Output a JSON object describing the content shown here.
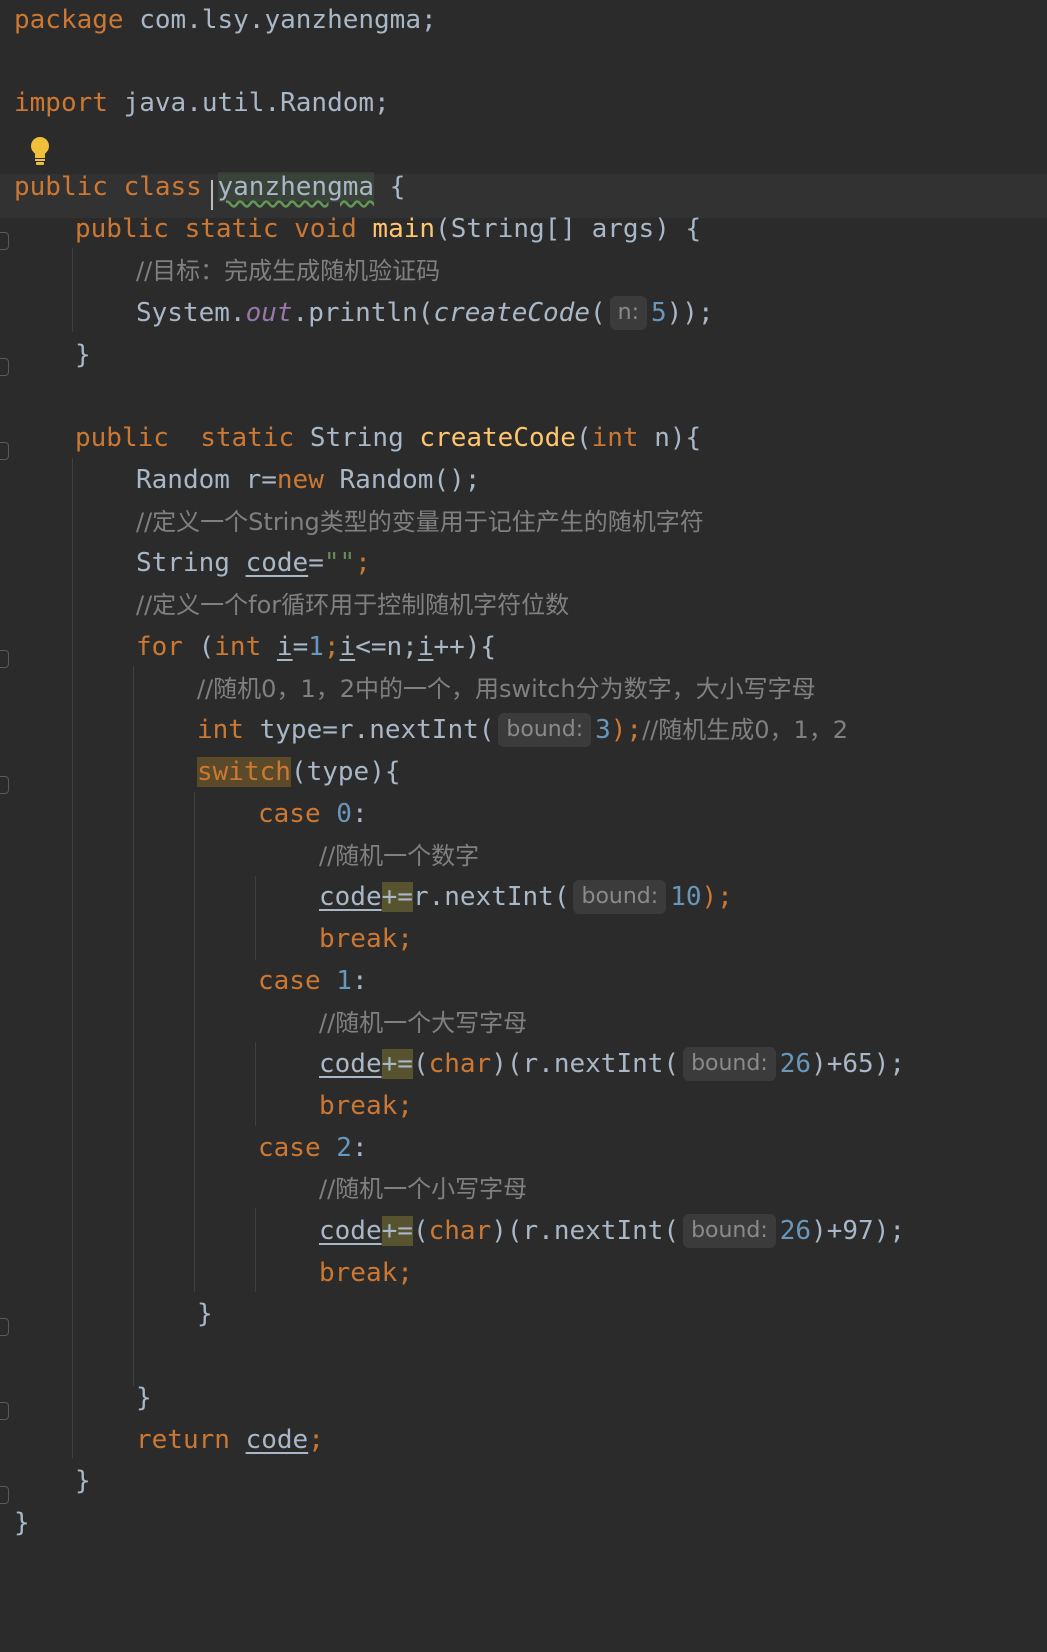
{
  "lines": {
    "l1": {
      "t1": "package",
      "t2": " com.lsy.yanzhengma;"
    },
    "l2": {
      "t1": "import",
      "t2": " java.util.Random;"
    },
    "l3": {
      "t1": "public class ",
      "t2": "yanzhengma",
      "t3": " {"
    },
    "l4": {
      "t1": "public static void ",
      "t2": "main",
      "t3": "(String[] args) {"
    },
    "l5": {
      "t1": "//目标：完成生成随机验证码"
    },
    "l6": {
      "t1": "System.",
      "t2": "out",
      "t3": ".println(",
      "t4": "createCode",
      "t5": "(",
      "hint": "n:",
      "t6": "5",
      "t7": "));"
    },
    "l7": {
      "t1": "}"
    },
    "l8": {
      "t1": "public  static ",
      "t2": "String ",
      "t3": "createCode",
      "t4": "(",
      "t5": "int",
      "t6": " n){"
    },
    "l9": {
      "t1": "Random r=",
      "t2": "new",
      "t3": " Random();"
    },
    "l10": {
      "t1": "//定义一个String类型的变量用于记住产生的随机字符"
    },
    "l11": {
      "t1": "String ",
      "t2": "code",
      "t3": "=",
      "t4": "\"\"",
      "t5": ";"
    },
    "l12": {
      "t1": "//定义一个for循环用于控制随机字符位数"
    },
    "l13": {
      "t1": "for",
      "t2": " (",
      "t3": "int",
      "t4": " ",
      "t5": "i",
      "t6": "=",
      "t7": "1",
      "t8": ";",
      "t9": "i",
      "t10": "<=n;",
      "t11": "i",
      "t12": "++){"
    },
    "l14": {
      "t1": "//随机0，1，2中的一个，用switch分为数字，大小写字母"
    },
    "l15": {
      "t1": "int",
      "t2": " type=r.nextInt(",
      "hint": "bound:",
      "t3": "3",
      "t4": ");",
      "t5": "//随机生成0，1，2"
    },
    "l16": {
      "t1": "switch",
      "t2": "(type){"
    },
    "l17": {
      "t1": "case ",
      "t2": "0",
      "t3": ":"
    },
    "l18": {
      "t1": "//随机一个数字"
    },
    "l19": {
      "t1": "code",
      "t2": "+=",
      "t3": "r.nextInt(",
      "hint": "bound:",
      "t4": "10",
      "t5": ");"
    },
    "l20": {
      "t1": "break;"
    },
    "l21": {
      "t1": "case ",
      "t2": "1",
      "t3": ":"
    },
    "l22": {
      "t1": "//随机一个大写字母"
    },
    "l23": {
      "t1": "code",
      "t2": "+=",
      "t3": "(",
      "t4": "char",
      "t5": ")(r.nextInt(",
      "hint": "bound:",
      "t6": "26",
      "t7": ")+65);"
    },
    "l24": {
      "t1": "break;"
    },
    "l25": {
      "t1": "case ",
      "t2": "2",
      "t3": ":"
    },
    "l26": {
      "t1": "//随机一个小写字母"
    },
    "l27": {
      "t1": "code",
      "t2": "+=",
      "t3": "(",
      "t4": "char",
      "t5": ")(r.nextInt(",
      "hint": "bound:",
      "t6": "26",
      "t7": ")+97);"
    },
    "l28": {
      "t1": "break;"
    },
    "l29": {
      "t1": "}"
    },
    "l30": {
      "t1": "}"
    },
    "l31": {
      "t1": "return ",
      "t2": "code",
      "t3": ";"
    },
    "l32": {
      "t1": "}"
    },
    "l33": {
      "t1": "}"
    }
  },
  "colors": {
    "background": "#2b2b2b",
    "keyword": "#cc7832",
    "number": "#6897bb",
    "function": "#ffc66d",
    "comment": "#808080",
    "field": "#9876aa"
  },
  "icons": {
    "intention": "lightbulb-icon"
  }
}
